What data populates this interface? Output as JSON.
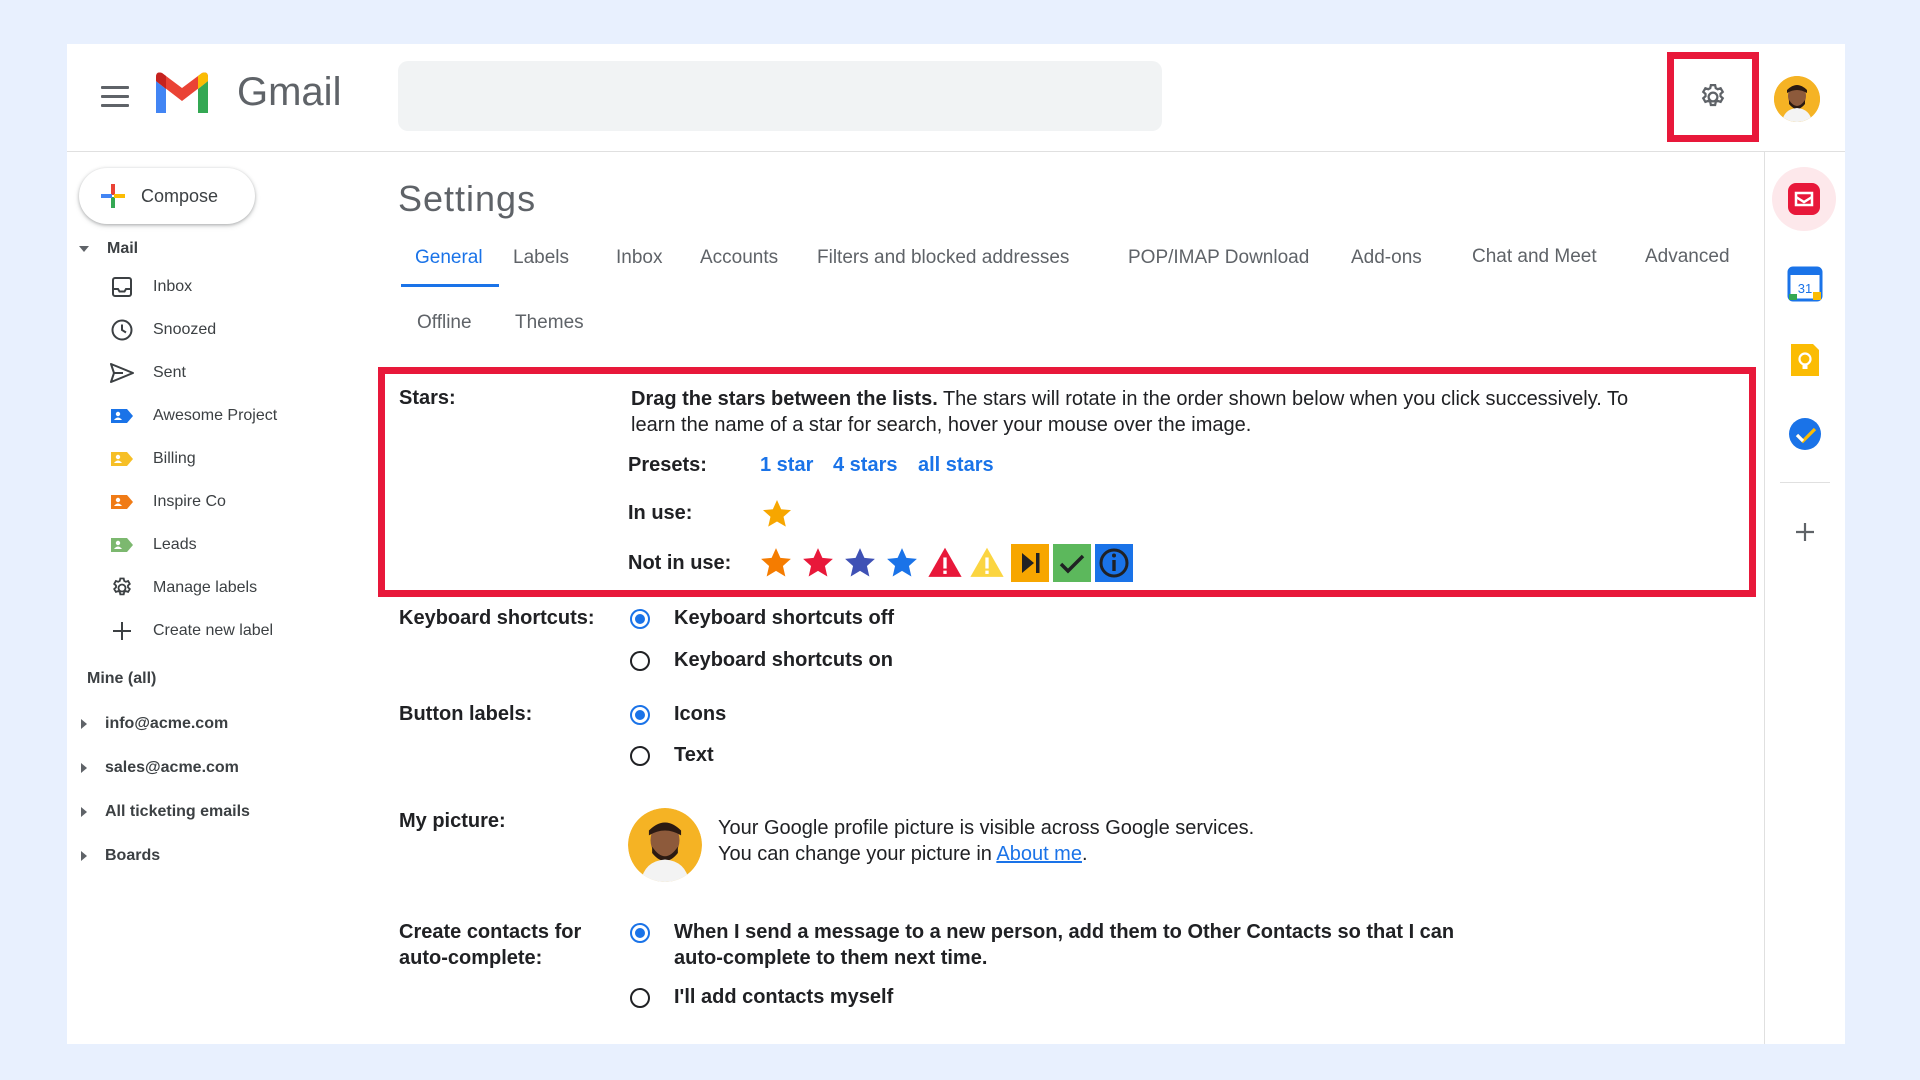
{
  "app": {
    "name": "Gmail"
  },
  "header": {
    "search_placeholder": ""
  },
  "compose": {
    "label": "Compose"
  },
  "nav": {
    "mail_section": "Mail",
    "items": [
      {
        "label": "Inbox",
        "icon": "inbox-icon"
      },
      {
        "label": "Snoozed",
        "icon": "clock-icon"
      },
      {
        "label": "Sent",
        "icon": "send-icon"
      },
      {
        "label": "Awesome Project",
        "icon": "label-icon",
        "color": "#1a73e8"
      },
      {
        "label": "Billing",
        "icon": "label-icon",
        "color": "#f6bf26"
      },
      {
        "label": "Inspire Co",
        "icon": "label-icon",
        "color": "#f07b16"
      },
      {
        "label": "Leads",
        "icon": "label-icon",
        "color": "#7cb86f"
      },
      {
        "label": "Manage labels",
        "icon": "gear-icon"
      },
      {
        "label": "Create new label",
        "icon": "plus-icon"
      }
    ],
    "mine_section": "Mine (all)",
    "accounts": [
      "info@acme.com",
      "sales@acme.com",
      "All ticketing emails",
      "Boards"
    ]
  },
  "settings": {
    "title": "Settings",
    "tabs": [
      "General",
      "Labels",
      "Inbox",
      "Accounts",
      "Filters and blocked addresses",
      "POP/IMAP Download",
      "Add-ons",
      "Chat and Meet",
      "Advanced",
      "Offline",
      "Themes"
    ],
    "active_tab": "General",
    "stars": {
      "label": "Stars:",
      "bold_intro": "Drag the stars between the lists.",
      "description_line1": "The stars will rotate in the order shown below when you click successively. To",
      "description_line2": "learn the name of a star for search, hover your mouse over the image.",
      "presets_label": "Presets:",
      "presets": [
        "1 star",
        "4 stars",
        "all stars"
      ],
      "in_use_label": "In use:",
      "not_in_use_label": "Not in use:",
      "in_use": [
        "yellow-star"
      ],
      "not_in_use": [
        "orange-star",
        "red-star",
        "purple-star",
        "blue-star",
        "red-bang",
        "yellow-bang",
        "orange-guillemet",
        "green-check",
        "blue-info"
      ]
    },
    "keyboard": {
      "label": "Keyboard shortcuts:",
      "options": [
        "Keyboard shortcuts off",
        "Keyboard shortcuts on"
      ],
      "selected": 0
    },
    "button_labels": {
      "label": "Button labels:",
      "options": [
        "Icons",
        "Text"
      ],
      "selected": 0
    },
    "my_picture": {
      "label": "My picture:",
      "line1": "Your Google profile picture is visible across Google services.",
      "line2_prefix": "You can change your picture in",
      "link": "About me",
      "line2_suffix": "."
    },
    "contacts": {
      "label_line1": "Create contacts for",
      "label_line2": "auto-complete:",
      "option1_line1": "When I send a message to a new person, add them to Other Contacts so that I can",
      "option1_line2": "auto-complete to them next time.",
      "option2": "I'll add contacts myself",
      "selected": 0
    }
  },
  "right_rail": {
    "calendar_day": "31",
    "icons": [
      "addon-icon",
      "calendar-icon",
      "keep-icon",
      "tasks-icon",
      "add-icon"
    ]
  },
  "colors": {
    "accent": "#1a73e8",
    "highlight": "#e8183a"
  }
}
